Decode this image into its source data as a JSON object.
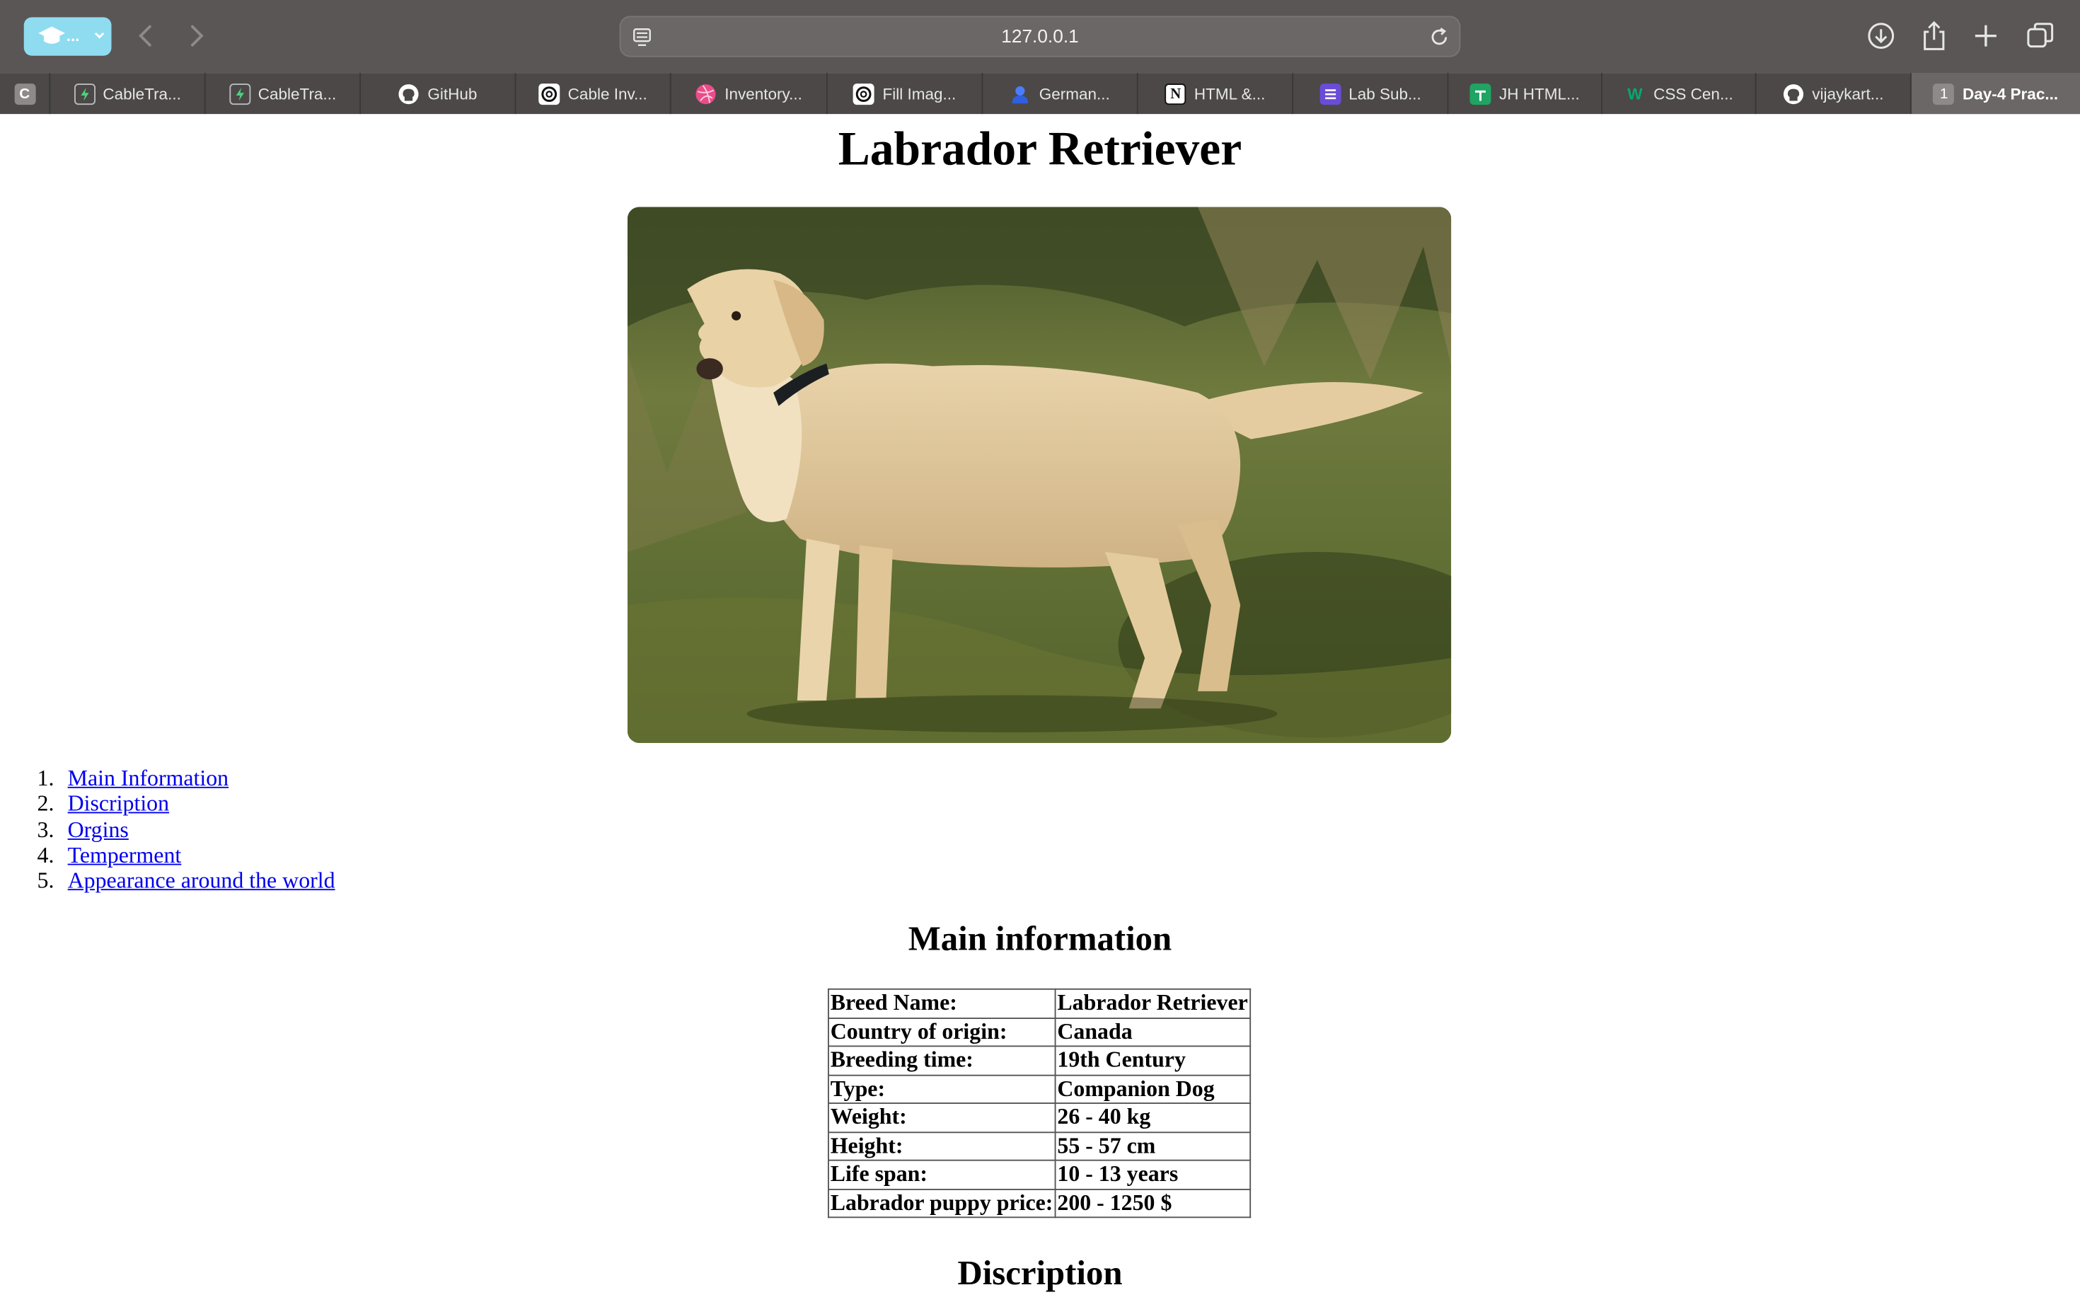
{
  "browser": {
    "profile_label": "...",
    "url": "127.0.0.1",
    "tabs": [
      {
        "label": "C",
        "icon": "c-badge-icon"
      },
      {
        "label": "CableTra...",
        "icon": "bolt-icon"
      },
      {
        "label": "CableTra...",
        "icon": "bolt-icon"
      },
      {
        "label": "GitHub",
        "icon": "github-icon"
      },
      {
        "label": "Cable Inv...",
        "icon": "openai-icon"
      },
      {
        "label": "Inventory...",
        "icon": "dribbble-icon"
      },
      {
        "label": "Fill Imag...",
        "icon": "openai-icon"
      },
      {
        "label": "German...",
        "icon": "user-icon"
      },
      {
        "label": "HTML &...",
        "icon": "notion-icon"
      },
      {
        "label": "Lab Sub...",
        "icon": "list-icon"
      },
      {
        "label": "JH HTML...",
        "icon": "sheets-icon"
      },
      {
        "label": "CSS Cen...",
        "icon": "w3-icon"
      },
      {
        "label": "vijaykart...",
        "icon": "github-icon"
      },
      {
        "label": "Day-4 Prac...",
        "badge": "1",
        "active": true
      }
    ]
  },
  "page": {
    "title": "Labrador Retriever",
    "hero_alt": "Labrador Retriever",
    "toc": [
      {
        "num": "1.",
        "label": "Main Information"
      },
      {
        "num": "2.",
        "label": "Discription"
      },
      {
        "num": "3.",
        "label": "Orgins"
      },
      {
        "num": "4.",
        "label": "Temperment"
      },
      {
        "num": "5.",
        "label": "Appearance around the world"
      }
    ],
    "main_heading": "Main information",
    "info_rows": [
      {
        "key": "Breed Name:",
        "value": "Labrador Retriever"
      },
      {
        "key": "Country of origin:",
        "value": "Canada"
      },
      {
        "key": "Breeding time:",
        "value": "19th Century"
      },
      {
        "key": "Type:",
        "value": "Companion Dog"
      },
      {
        "key": "Weight:",
        "value": "26 - 40 kg"
      },
      {
        "key": "Height:",
        "value": "55 - 57 cm"
      },
      {
        "key": "Life span:",
        "value": "10 - 13 years"
      },
      {
        "key": "Labrador puppy price:",
        "value": "200 - 1250 $"
      }
    ],
    "description_heading": "Discription"
  }
}
